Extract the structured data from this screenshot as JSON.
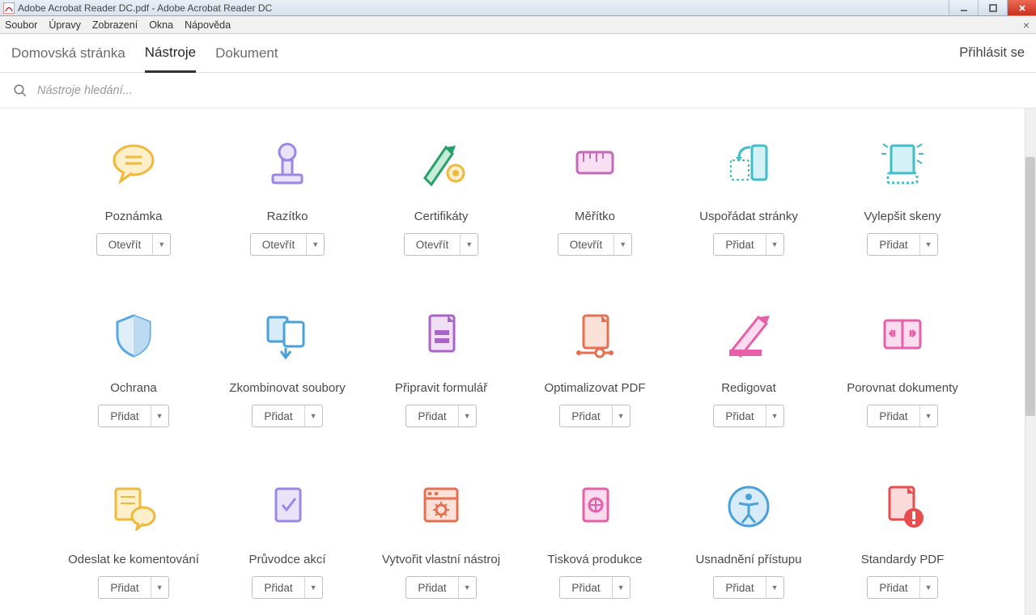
{
  "window": {
    "title": "Adobe Acrobat Reader DC.pdf - Adobe Acrobat Reader DC"
  },
  "menu": {
    "items": [
      "Soubor",
      "Úpravy",
      "Zobrazení",
      "Okna",
      "Nápověda"
    ]
  },
  "tabs": {
    "home": "Domovská stránka",
    "tools": "Nástroje",
    "document": "Dokument",
    "signin": "Přihlásit se",
    "active": "tools"
  },
  "search": {
    "placeholder": "Nástroje hledání..."
  },
  "actions": {
    "open": "Otevřít",
    "add": "Přidat"
  },
  "tools": [
    {
      "id": "poznamka",
      "label": "Poznámka",
      "action": "open",
      "icon": "comment",
      "color": "#efb93e"
    },
    {
      "id": "razitko",
      "label": "Razítko",
      "action": "open",
      "icon": "stamp",
      "color": "#9a86e6"
    },
    {
      "id": "certifikaty",
      "label": "Certifikáty",
      "action": "open",
      "icon": "cert",
      "color": "#27a06a"
    },
    {
      "id": "meritko",
      "label": "Měřítko",
      "action": "open",
      "icon": "ruler",
      "color": "#c869b8"
    },
    {
      "id": "usporadat",
      "label": "Uspořádat stránky",
      "action": "add",
      "icon": "organize",
      "color": "#3fbdc8"
    },
    {
      "id": "vylepsit",
      "label": "Vylepšit skeny",
      "action": "add",
      "icon": "scan",
      "color": "#3fbdc8"
    },
    {
      "id": "ochrana",
      "label": "Ochrana",
      "action": "add",
      "icon": "shield",
      "color": "#5aa6e6"
    },
    {
      "id": "zkombinovat",
      "label": "Zkombinovat soubory",
      "action": "add",
      "icon": "combine",
      "color": "#4aa0d8"
    },
    {
      "id": "pripravit",
      "label": "Připravit formulář",
      "action": "add",
      "icon": "form",
      "color": "#a864c9"
    },
    {
      "id": "optimalizovat",
      "label": "Optimalizovat PDF",
      "action": "add",
      "icon": "optimize",
      "color": "#e87050"
    },
    {
      "id": "redigovat",
      "label": "Redigovat",
      "action": "add",
      "icon": "redact",
      "color": "#e75fa8"
    },
    {
      "id": "porovnat",
      "label": "Porovnat dokumenty",
      "action": "add",
      "icon": "compare",
      "color": "#e75fa8"
    },
    {
      "id": "odeslat",
      "label": "Odeslat ke komentování",
      "action": "add",
      "icon": "sendcomment",
      "color": "#efb93e"
    },
    {
      "id": "pruvodce",
      "label": "Průvodce akcí",
      "action": "add",
      "icon": "wizard",
      "color": "#9a86e6"
    },
    {
      "id": "vytvorit",
      "label": "Vytvořit vlastní nástroj",
      "action": "add",
      "icon": "custom",
      "color": "#e87050"
    },
    {
      "id": "tiskova",
      "label": "Tisková produkce",
      "action": "add",
      "icon": "print",
      "color": "#e75fa8"
    },
    {
      "id": "usnadneni",
      "label": "Usnadnění přístupu",
      "action": "add",
      "icon": "access",
      "color": "#4aa0d8"
    },
    {
      "id": "standardy",
      "label": "Standardy PDF",
      "action": "add",
      "icon": "standards",
      "color": "#e84c4c"
    }
  ]
}
